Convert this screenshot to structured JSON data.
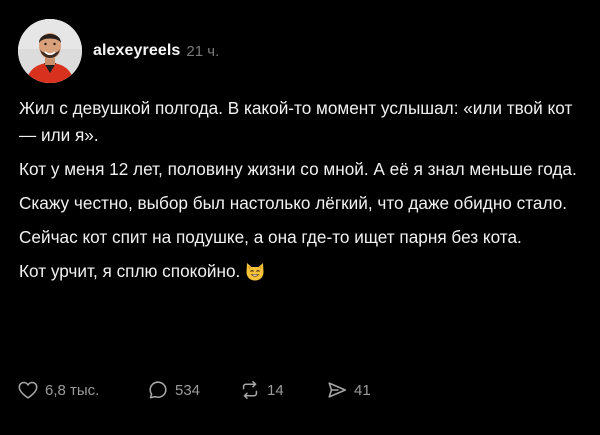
{
  "author": {
    "username": "alexeyreels",
    "time": "21 ч."
  },
  "post": {
    "paragraphs": [
      "Жил с девушкой полгода. В какой-то момент услышал: «или твой кот — или я».",
      "Кот у меня 12 лет, половину жизни со мной. А её я знал меньше года.",
      "Скажу честно, выбор был настолько лёгкий, что даже обидно стало.",
      "Сейчас кот спит на подушке, а она где-то ищет парня без кота."
    ],
    "last_line": "Кот урчит, я сплю спокойно.",
    "emoji": "smiling-cat-emoji"
  },
  "actions": {
    "likes": "6,8 тыс.",
    "comments": "534",
    "reposts": "14",
    "shares": "41"
  },
  "colors": {
    "background": "#000000",
    "text": "#f1f1f1",
    "muted": "#7a7a7a",
    "icon": "#9b9b9b"
  }
}
